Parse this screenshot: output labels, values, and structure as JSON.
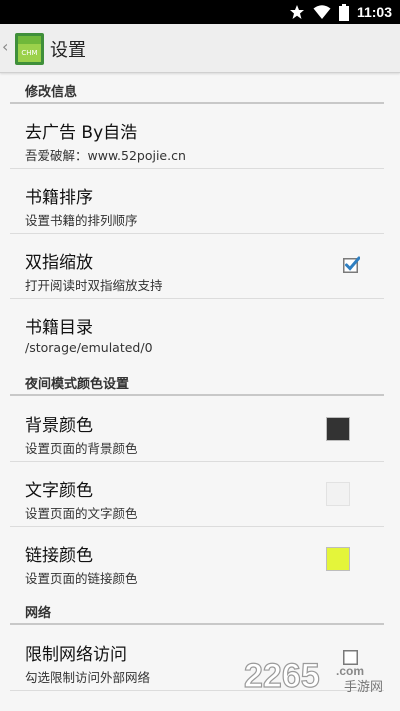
{
  "status_bar": {
    "time": "11:03",
    "icons": [
      "star-icon",
      "wifi-icon",
      "battery-icon"
    ]
  },
  "app_bar": {
    "title": "设置",
    "app_icon_label": "CHM"
  },
  "categories": {
    "modify_info": "修改信息",
    "night_mode": "夜间模式颜色设置",
    "network": "网络"
  },
  "prefs": {
    "remove_ads": {
      "title": "去广告 By自浩",
      "summary": "吾爱破解：www.52pojie.cn"
    },
    "book_sort": {
      "title": "书籍排序",
      "summary": "设置书籍的排列顺序"
    },
    "pinch_zoom": {
      "title": "双指缩放",
      "summary": "打开阅读时双指缩放支持",
      "checked": true
    },
    "book_dir": {
      "title": "书籍目录",
      "summary": "/storage/emulated/0"
    },
    "bg_color": {
      "title": "背景颜色",
      "summary": "设置页面的背景颜色",
      "color": "#333333"
    },
    "text_color": {
      "title": "文字颜色",
      "summary": "设置页面的文字颜色",
      "color": "#f2f2f2"
    },
    "link_color": {
      "title": "链接颜色",
      "summary": "设置页面的链接颜色",
      "color": "#e4f53a"
    },
    "restrict_network": {
      "title": "限制网络访问",
      "summary": "勾选限制访问外部网络",
      "checked": false
    }
  },
  "accent_color": "#2f7fc1",
  "watermark": {
    "number": "2265",
    "suffix": ".com",
    "cn": "手游网"
  }
}
